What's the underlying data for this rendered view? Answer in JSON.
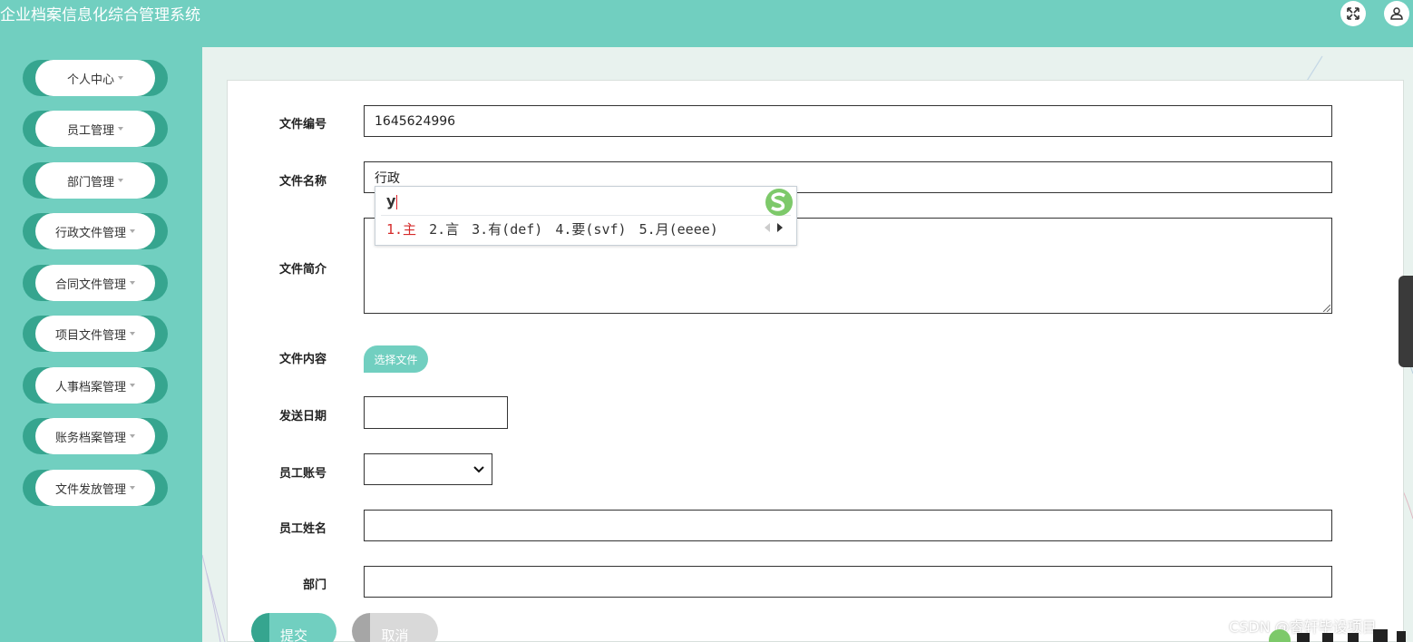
{
  "header": {
    "title": "企业档案信息化综合管理系统",
    "icons": [
      "fullscreen-icon",
      "user-icon"
    ],
    "colors": {
      "header_bg": "#71cfc0"
    }
  },
  "sidebar": {
    "items": [
      {
        "label": "个人中心"
      },
      {
        "label": "员工管理"
      },
      {
        "label": "部门管理"
      },
      {
        "label": "行政文件管理"
      },
      {
        "label": "合同文件管理"
      },
      {
        "label": "项目文件管理"
      },
      {
        "label": "人事档案管理"
      },
      {
        "label": "账务档案管理"
      },
      {
        "label": "文件发放管理"
      }
    ]
  },
  "form": {
    "file_no": {
      "label": "文件编号",
      "value": "1645624996"
    },
    "file_name": {
      "label": "文件名称",
      "value": "行政"
    },
    "file_desc": {
      "label": "文件简介",
      "value": ""
    },
    "file_content": {
      "label": "文件内容",
      "button": "选择文件"
    },
    "send_date": {
      "label": "发送日期",
      "value": ""
    },
    "emp_account": {
      "label": "员工账号",
      "value": ""
    },
    "emp_name": {
      "label": "员工姓名",
      "value": ""
    },
    "department": {
      "label": "部门",
      "value": ""
    },
    "submit": "提交",
    "cancel": "取消"
  },
  "ime": {
    "input": "y",
    "candidates": [
      "1.主",
      "2.言",
      "3.有(def)",
      "4.要(svf)",
      "5.月(eeee)"
    ]
  },
  "watermark": "CSDN @睿轩毕设项目"
}
